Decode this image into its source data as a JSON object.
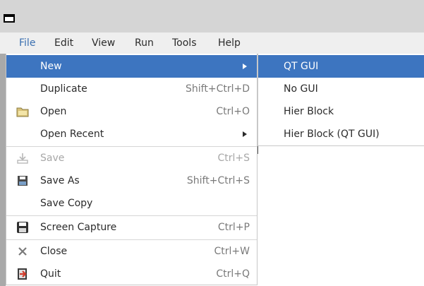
{
  "menubar": {
    "items": [
      {
        "label": "File",
        "active": true
      },
      {
        "label": "Edit"
      },
      {
        "label": "View"
      },
      {
        "label": "Run"
      },
      {
        "label": "Tools"
      },
      {
        "label": "Help"
      }
    ]
  },
  "file_menu": {
    "items": [
      {
        "label": "New",
        "accelerator": "",
        "submenu": true,
        "highlighted": true
      },
      {
        "label": "Duplicate",
        "accelerator": "Shift+Ctrl+D"
      },
      {
        "label": "Open",
        "accelerator": "Ctrl+O",
        "icon": "folder-icon"
      },
      {
        "label": "Open Recent",
        "accelerator": "",
        "submenu": true
      },
      {
        "label": "Save",
        "accelerator": "Ctrl+S",
        "icon": "save-icon",
        "disabled": true
      },
      {
        "label": "Save As",
        "accelerator": "Shift+Ctrl+S",
        "icon": "save-as-icon"
      },
      {
        "label": "Save Copy",
        "accelerator": ""
      },
      {
        "label": "Screen Capture",
        "accelerator": "Ctrl+P",
        "icon": "floppy-icon"
      },
      {
        "label": "Close",
        "accelerator": "Ctrl+W",
        "icon": "close-icon"
      },
      {
        "label": "Quit",
        "accelerator": "Ctrl+Q",
        "icon": "exit-icon"
      }
    ]
  },
  "new_submenu": {
    "items": [
      {
        "label": "QT GUI",
        "highlighted": true
      },
      {
        "label": "No GUI"
      },
      {
        "label": "Hier Block"
      },
      {
        "label": "Hier Block (QT GUI)"
      }
    ]
  },
  "colors": {
    "highlight": "#3d75c0",
    "menubar_bg": "#efefef",
    "titlebar_bg": "#d5d5d5",
    "active_menu_text": "#3a6fb0"
  }
}
